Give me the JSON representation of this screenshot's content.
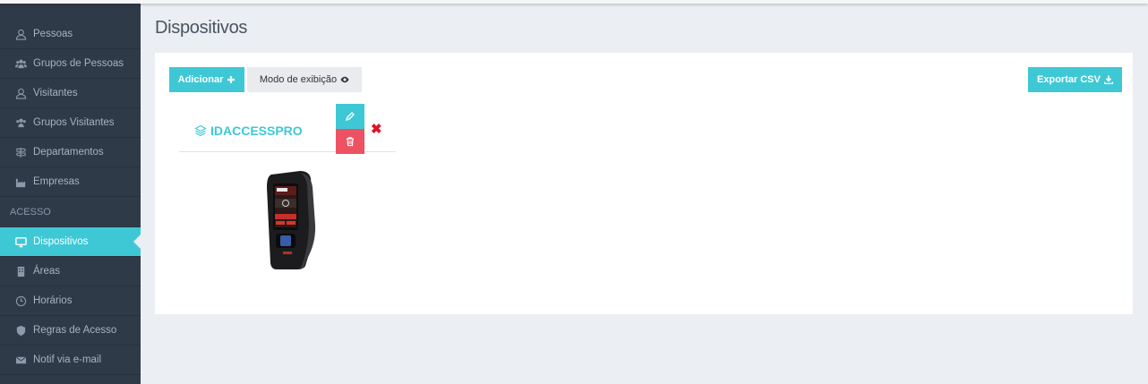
{
  "sidebar": {
    "items": [
      {
        "label": "Pessoas",
        "icon": "user-icon"
      },
      {
        "label": "Grupos de Pessoas",
        "icon": "users-icon"
      },
      {
        "label": "Visitantes",
        "icon": "user-icon"
      },
      {
        "label": "Grupos Visitantes",
        "icon": "users-icon"
      },
      {
        "label": "Departamentos",
        "icon": "signpost-icon"
      },
      {
        "label": "Empresas",
        "icon": "industry-icon"
      }
    ],
    "section": "ACESSO",
    "access_items": [
      {
        "label": "Dispositivos",
        "icon": "monitor-icon",
        "active": true
      },
      {
        "label": "Áreas",
        "icon": "building-icon"
      },
      {
        "label": "Horários",
        "icon": "clock-icon"
      },
      {
        "label": "Regras de Acesso",
        "icon": "shield-icon"
      },
      {
        "label": "Notif via e-mail",
        "icon": "envelope-icon"
      }
    ]
  },
  "page": {
    "title": "Dispositivos"
  },
  "toolbar": {
    "add_label": "Adicionar",
    "mode_label": "Modo de exibição",
    "export_label": "Exportar CSV"
  },
  "device_card": {
    "name": "IDACCESSPRO"
  },
  "colors": {
    "accent": "#3ec8d6",
    "danger": "#ee5262",
    "sidebar_bg": "#2e3a48",
    "close": "#e0112b"
  }
}
